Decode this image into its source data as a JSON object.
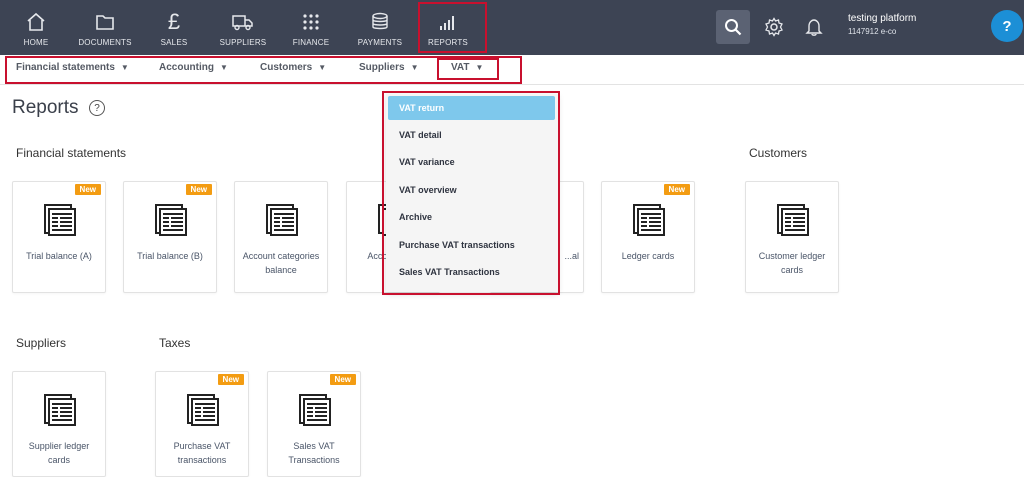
{
  "topnav": {
    "items": [
      {
        "label": "HOME",
        "icon": "home-icon"
      },
      {
        "label": "DOCUMENTS",
        "icon": "folder-icon"
      },
      {
        "label": "SALES",
        "icon": "pound-icon"
      },
      {
        "label": "SUPPLIERS",
        "icon": "truck-icon"
      },
      {
        "label": "FINANCE",
        "icon": "grid-dots-icon"
      },
      {
        "label": "PAYMENTS",
        "icon": "coins-icon"
      },
      {
        "label": "REPORTS",
        "icon": "bar-chart-icon"
      }
    ],
    "user_name": "testing platform",
    "user_company": "1147912 e-co",
    "help_label": "?"
  },
  "subnav": {
    "items": [
      {
        "label": "Financial statements"
      },
      {
        "label": "Accounting"
      },
      {
        "label": "Customers"
      },
      {
        "label": "Suppliers"
      },
      {
        "label": "VAT"
      }
    ],
    "caret": "▼"
  },
  "page": {
    "title": "Reports",
    "help": "?"
  },
  "sections": {
    "financial_statements": "Financial statements",
    "customers": "Customers",
    "suppliers": "Suppliers",
    "taxes": "Taxes"
  },
  "cards": {
    "new_badge": "New",
    "trial_a": "Trial balance (A)",
    "trial_b": "Trial balance (B)",
    "account_categories": "Account categories balance",
    "account_partial": "Accou... ov...",
    "general_partial": "...al",
    "ledger_cards": "Ledger cards",
    "customer_ledger": "Customer ledger cards",
    "supplier_ledger": "Supplier ledger cards",
    "purchase_vat": "Purchase VAT transactions",
    "sales_vat": "Sales VAT Transactions"
  },
  "vat_menu": {
    "items": [
      "VAT return",
      "VAT detail",
      "VAT variance",
      "VAT overview",
      "Archive",
      "Purchase VAT transactions",
      "Sales VAT Transactions"
    ],
    "active_index": 0
  },
  "colors": {
    "topbar": "#3d4454",
    "highlight": "#c8102e",
    "badge": "#f39c12",
    "active_item": "#7ec8ec",
    "help": "#1c8fd6"
  }
}
